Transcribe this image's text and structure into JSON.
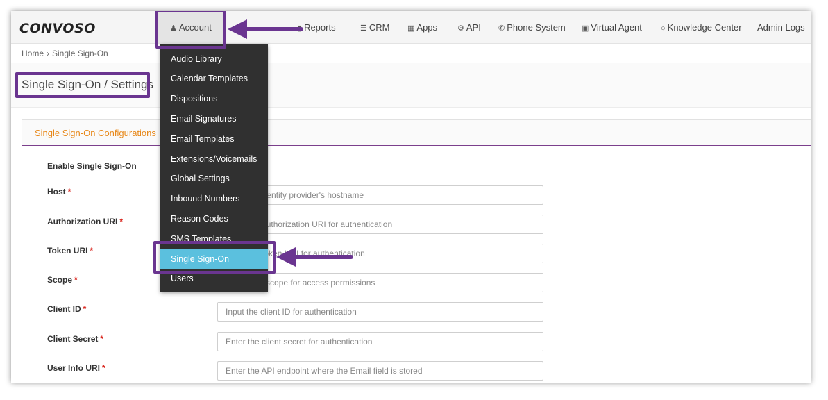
{
  "logo": "CONVOSO",
  "nav": {
    "account": "Account",
    "reports": "Reports",
    "crm": "CRM",
    "apps": "Apps",
    "api": "API",
    "phone_system": "Phone System",
    "virtual_agent": "Virtual Agent",
    "knowledge_center": "Knowledge Center",
    "admin_logs": "Admin Logs"
  },
  "icons": {
    "account": "user-icon",
    "reports": "bar-chart-icon",
    "crm": "list-icon",
    "apps": "grid-icon",
    "api": "gear-icon",
    "phone_system": "phone-icon",
    "virtual_agent": "monitor-icon",
    "knowledge_center": "lightbulb-icon"
  },
  "breadcrumb": {
    "home": "Home",
    "separator": "›",
    "current": "Single Sign-On"
  },
  "page_title": "Single Sign-On / Settings",
  "panel": {
    "title": "Single Sign-On Configurations"
  },
  "form": {
    "enable_label": "Enable Single Sign-On",
    "required_mark": "*",
    "fields": [
      {
        "label": "Host",
        "placeholder": "Input the identity provider's hostname"
      },
      {
        "label": "Authorization URI",
        "placeholder": "Enter the authorization URI for authentication"
      },
      {
        "label": "Token URI",
        "placeholder": "Enter the token URI for authentication"
      },
      {
        "label": "Scope",
        "placeholder": "Define the scope for access permissions"
      },
      {
        "label": "Client ID",
        "placeholder": "Input the client ID for authentication"
      },
      {
        "label": "Client Secret",
        "placeholder": "Enter the client secret for authentication"
      },
      {
        "label": "User Info URI",
        "placeholder": "Enter the API endpoint where the Email field is stored"
      }
    ]
  },
  "account_menu": {
    "items": [
      "Audio Library",
      "Calendar Templates",
      "Dispositions",
      "Email Signatures",
      "Email Templates",
      "Extensions/Voicemails",
      "Global Settings",
      "Inbound Numbers",
      "Reason Codes",
      "SMS Templates",
      "Single Sign-On",
      "Users"
    ],
    "active_index": 10
  },
  "colors": {
    "highlight": "#6a3590",
    "accent_orange": "#e8891b",
    "menu_bg": "#303030",
    "menu_active": "#5bc0de",
    "required": "#d9251d"
  }
}
